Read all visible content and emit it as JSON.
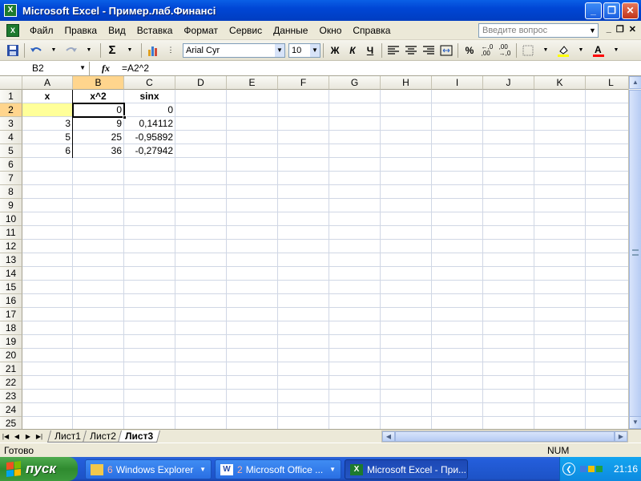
{
  "window": {
    "title": "Microsoft Excel - Пример.лаб.Финансі",
    "app_icon": "X",
    "controls": [
      "_",
      "❐",
      "✕"
    ]
  },
  "menu": {
    "items": [
      "Файл",
      "Правка",
      "Вид",
      "Вставка",
      "Формат",
      "Сервис",
      "Данные",
      "Окно",
      "Справка"
    ],
    "help_placeholder": "Введите вопрос",
    "mdi_controls": [
      "_",
      "❐",
      "✕"
    ]
  },
  "toolbar": {
    "font_name": "Arial Cyr",
    "font_size": "10",
    "bold": "Ж",
    "italic": "К",
    "underline": "Ч",
    "percent": "%",
    "autosum": "Σ"
  },
  "formula_bar": {
    "name_box": "B2",
    "fx": "fx",
    "formula": "=A2^2"
  },
  "sheet": {
    "columns": [
      "A",
      "B",
      "C",
      "D",
      "E",
      "F",
      "G",
      "H",
      "I",
      "J",
      "K",
      "L"
    ],
    "selected_column": "B",
    "rows": [
      "1",
      "2",
      "3",
      "4",
      "5",
      "6",
      "7",
      "8",
      "9",
      "10",
      "11",
      "12",
      "13",
      "14",
      "15",
      "16",
      "17",
      "18",
      "19",
      "20",
      "21",
      "22",
      "23",
      "24",
      "25"
    ],
    "selected_row": "2",
    "headers": {
      "a": "x",
      "b": "x^2",
      "c": "sinx"
    },
    "data": [
      {
        "a": "",
        "b": "0",
        "c": "0"
      },
      {
        "a": "3",
        "b": "9",
        "c": "0,14112"
      },
      {
        "a": "5",
        "b": "25",
        "c": "-0,95892"
      },
      {
        "a": "6",
        "b": "36",
        "c": "-0,27942"
      }
    ],
    "active_cell": "B2"
  },
  "tabs": {
    "sheets": [
      "Лист1",
      "Лист2",
      "Лист3"
    ],
    "active": "Лист3"
  },
  "status": {
    "text": "Готово",
    "num": "NUM"
  },
  "taskbar": {
    "start_label": "пуск",
    "tasks": [
      {
        "label": "Windows Explorer",
        "count": "6"
      },
      {
        "label": "Microsoft Office ...",
        "count": "2"
      },
      {
        "label": "Microsoft Excel - При..."
      }
    ],
    "clock": "21:16"
  }
}
